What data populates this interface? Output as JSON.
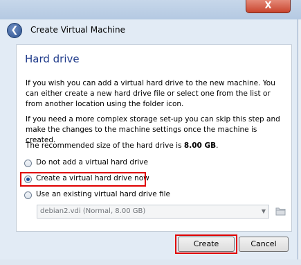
{
  "window": {
    "close_glyph": "X"
  },
  "header": {
    "back_icon": "back-arrow-icon",
    "title": "Create Virtual Machine"
  },
  "page": {
    "heading": "Hard drive",
    "para1": "If you wish you can add a virtual hard drive to the new machine. You can either create a new hard drive file or select one from the list or from another location using the folder icon.",
    "para2": "If you need a more complex storage set-up you can skip this step and make the changes to the machine settings once the machine is created.",
    "recommended_prefix": "The recommended size of the hard drive is ",
    "recommended_size": "8.00 GB",
    "recommended_suffix": "."
  },
  "options": [
    {
      "label": "Do not add a virtual hard drive",
      "selected": false
    },
    {
      "label": "Create a virtual hard drive now",
      "selected": true
    },
    {
      "label": "Use an existing virtual hard drive file",
      "selected": false
    }
  ],
  "existing_disk": {
    "value": "debian2.vdi (Normal, 8.00 GB)",
    "folder_icon": "folder-icon"
  },
  "buttons": {
    "create": "Create",
    "cancel": "Cancel"
  },
  "highlight_color": "#e00000"
}
